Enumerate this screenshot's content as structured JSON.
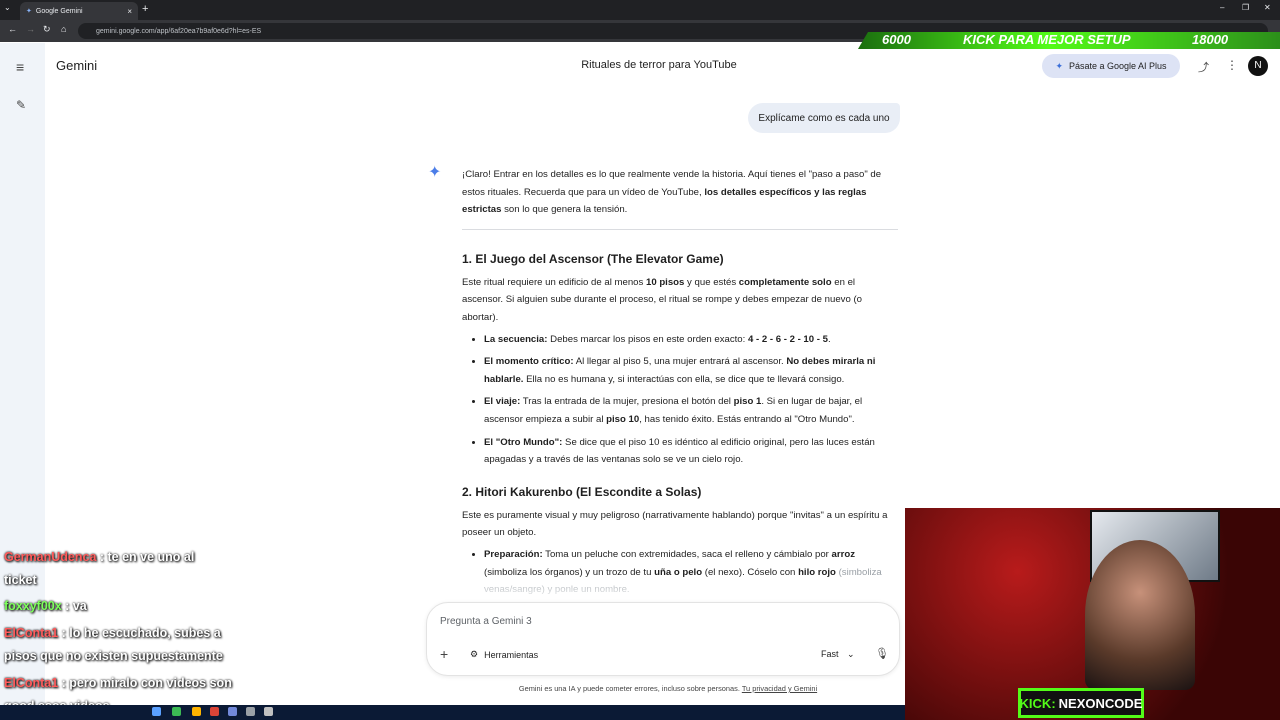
{
  "browser": {
    "tab_title": "Google Gemini",
    "new_tab": "+",
    "close": "×",
    "url": "gemini.google.com/app/6af20ea7b9af0e6d?hl=es-ES"
  },
  "overlay_banner": {
    "left_value": "6000",
    "message": "KICK PARA MEJOR SETUP",
    "right_value": "18000"
  },
  "header": {
    "brand": "Gemini",
    "conversation_title": "Rituales de terror para YouTube",
    "upgrade_label": "Pásate a Google AI Plus",
    "avatar": "N"
  },
  "conversation": {
    "user_message": "Explícame como es cada uno",
    "intro_1": "¡Claro! Entrar en los detalles es lo que realmente vende la historia. Aquí tienes el \"paso a paso\" de estos rituales. Recuerda que para un vídeo de YouTube, ",
    "intro_bold": "los detalles específicos y las reglas estrictas",
    "intro_2": " son lo que genera la tensión.",
    "section1": {
      "title": "1. El Juego del Ascensor (The Elevator Game)",
      "p_a": "Este ritual requiere un edificio de al menos ",
      "p_b": "10 pisos",
      "p_c": " y que estés ",
      "p_d": "completamente solo",
      "p_e": " en el ascensor. Si alguien sube durante el proceso, el ritual se rompe y debes empezar de nuevo (o abortar).",
      "items": [
        {
          "label": "La secuencia:",
          "t1": " Debes marcar los pisos en este orden exacto: ",
          "b1": "4 - 2 - 6 - 2 - 10 - 5",
          "t2": "."
        },
        {
          "label": "El momento crítico:",
          "t1": " Al llegar al piso 5, una mujer entrará al ascensor. ",
          "b1": "No debes mirarla ni hablarle.",
          "t2": " Ella no es humana y, si interactúas con ella, se dice que te llevará consigo."
        },
        {
          "label": "El viaje:",
          "t1": " Tras la entrada de la mujer, presiona el botón del ",
          "b1": "piso 1",
          "t2": ". Si en lugar de bajar, el ascensor empieza a subir al ",
          "b2": "piso 10",
          "t3": ", has tenido éxito. Estás entrando al \"Otro Mundo\"."
        },
        {
          "label": "El \"Otro Mundo\":",
          "t1": " Se dice que el piso 10 es idéntico al edificio original, pero las luces están apagadas y a través de las ventanas solo se ve un cielo rojo."
        }
      ]
    },
    "section2": {
      "title": "2. Hitori Kakurenbo (El Escondite a Solas)",
      "paragraph": "Este es puramente visual y muy peligroso (narrativamente hablando) porque \"invitas\" a un espíritu a poseer un objeto.",
      "item_label": "Preparación:",
      "item_t1": " Toma un peluche con extremidades, saca el relleno y cámbialo por ",
      "item_b1": "arroz",
      "item_t2": " (simboliza los órganos) y un trozo de tu ",
      "item_b2": "uña o pelo",
      "item_t3": " (el nexo). Cóselo con ",
      "item_b3": "hilo rojo",
      "item_t4": " (simboliza venas/sangre) y ponle un nombre."
    }
  },
  "input": {
    "placeholder": "Pregunta a Gemini 3",
    "tools_label": "Herramientas",
    "model_label": "Fast"
  },
  "disclaimer": {
    "text": "Gemini es una IA y puede cometer errores, incluso sobre personas. ",
    "link": "Tu privacidad y Gemini"
  },
  "chat_overlay": [
    {
      "user": "GermanUdenca",
      "message": " : te en ve uno al"
    },
    {
      "user": "",
      "message": "ticket"
    },
    {
      "user": "foxxyf00x",
      "message": " : va"
    },
    {
      "user": "ElConta1",
      "message": " : lo he escuchado, subes a"
    },
    {
      "user": "",
      "message": "pisos que no existen supuestamente"
    },
    {
      "user": "ElConta1",
      "message": " : pero miralo con videos son"
    },
    {
      "user": "",
      "message": "good esos videos"
    }
  ],
  "webcam": {
    "badge_prefix": "KICK:",
    "badge_name": "NEXONCODE"
  }
}
